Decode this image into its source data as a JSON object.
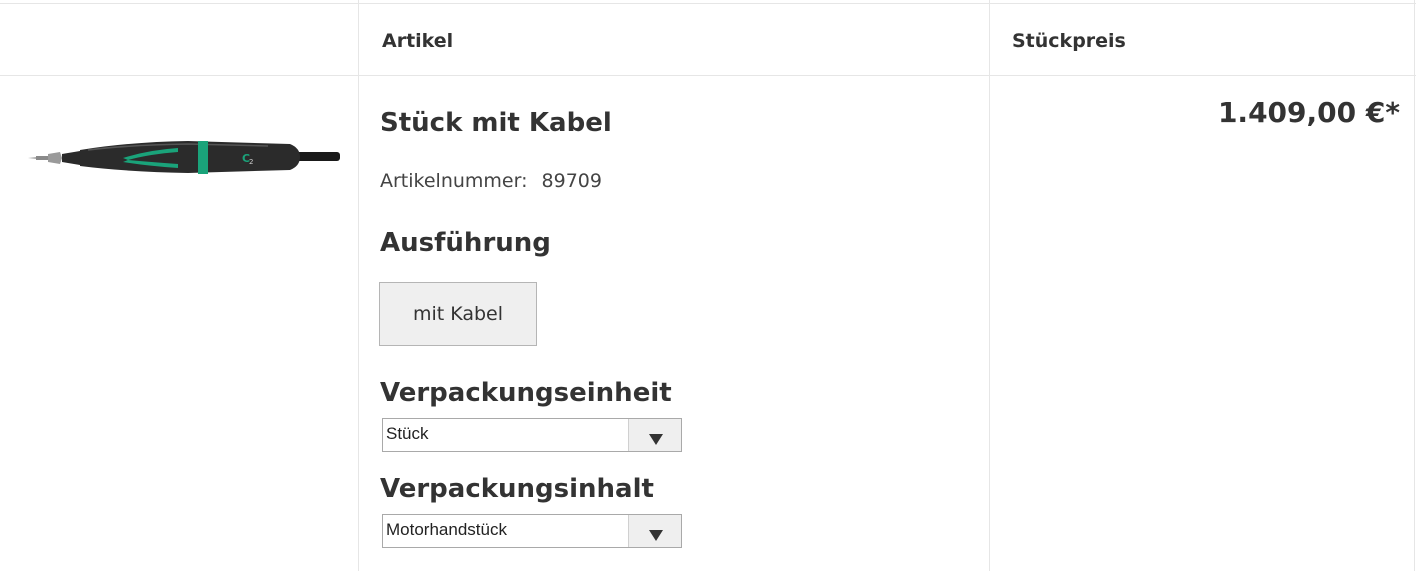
{
  "table": {
    "headers": {
      "image": "",
      "article": "Artikel",
      "unit_price": "Stückpreis"
    }
  },
  "product": {
    "image_icon": "electric-handpiece-product-image",
    "title": "Stück mit Kabel",
    "article_number_label": "Artikelnummer:",
    "article_number": "89709",
    "price": "1.409,00 €*"
  },
  "options": {
    "variant": {
      "heading": "Ausführung",
      "selected_label": "mit Kabel"
    },
    "packing_unit": {
      "heading": "Verpackungseinheit",
      "selected": "Stück"
    },
    "packing_content": {
      "heading": "Verpackungsinhalt",
      "selected": "Motorhandstück"
    }
  },
  "colors": {
    "accent": "#1aa37a",
    "text": "#333333",
    "border": "#e6e6e6"
  }
}
